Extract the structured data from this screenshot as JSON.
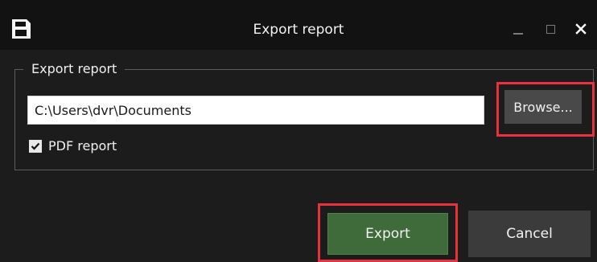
{
  "window": {
    "title": "Export report",
    "icon": "floppy-disk-icon",
    "controls": {
      "minimize": "minimize-icon",
      "maximize": "maximize-icon",
      "close": "close-icon"
    }
  },
  "group": {
    "legend": "Export report",
    "path_value": "C:\\Users\\dvr\\Documents",
    "browse_label": "Browse...",
    "pdf_checkbox": {
      "label": "PDF report",
      "checked": true
    }
  },
  "actions": {
    "export_label": "Export",
    "cancel_label": "Cancel"
  },
  "colors": {
    "background": "#1c1c1c",
    "titlebar": "#121212",
    "export_button": "#3f6b3a",
    "secondary_button": "#3b3b3b",
    "highlight_border": "#e5323d"
  }
}
